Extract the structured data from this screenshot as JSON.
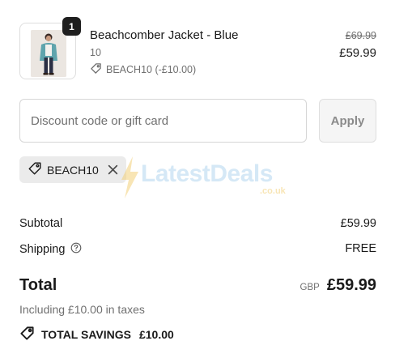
{
  "cart_item": {
    "quantity": "1",
    "title": "Beachcomber Jacket - Blue",
    "variant": "10",
    "discount": "BEACH10 (-£10.00)",
    "original_price": "£69.99",
    "price": "£59.99"
  },
  "discount_form": {
    "placeholder": "Discount code or gift card",
    "apply_label": "Apply"
  },
  "applied_code": {
    "code": "BEACH10"
  },
  "watermark": {
    "text": "LatestDeals",
    "domain": ".co.uk"
  },
  "summary": {
    "subtotal_label": "Subtotal",
    "subtotal_value": "£59.99",
    "shipping_label": "Shipping",
    "shipping_value": "FREE",
    "total_label": "Total",
    "currency": "GBP",
    "total_value": "£59.99",
    "taxes_note": "Including £10.00 in taxes",
    "savings_label": "TOTAL SAVINGS",
    "savings_value": "£10.00"
  },
  "icons": {
    "tag": "tag-icon",
    "close": "close-icon",
    "help": "help-circle-icon",
    "savings_tag": "tag-icon"
  },
  "colors": {
    "badge": "#1f1f1f",
    "muted_text": "#707070",
    "chip_bg": "#ebebeb",
    "apply_bg": "#f5f5f5"
  }
}
